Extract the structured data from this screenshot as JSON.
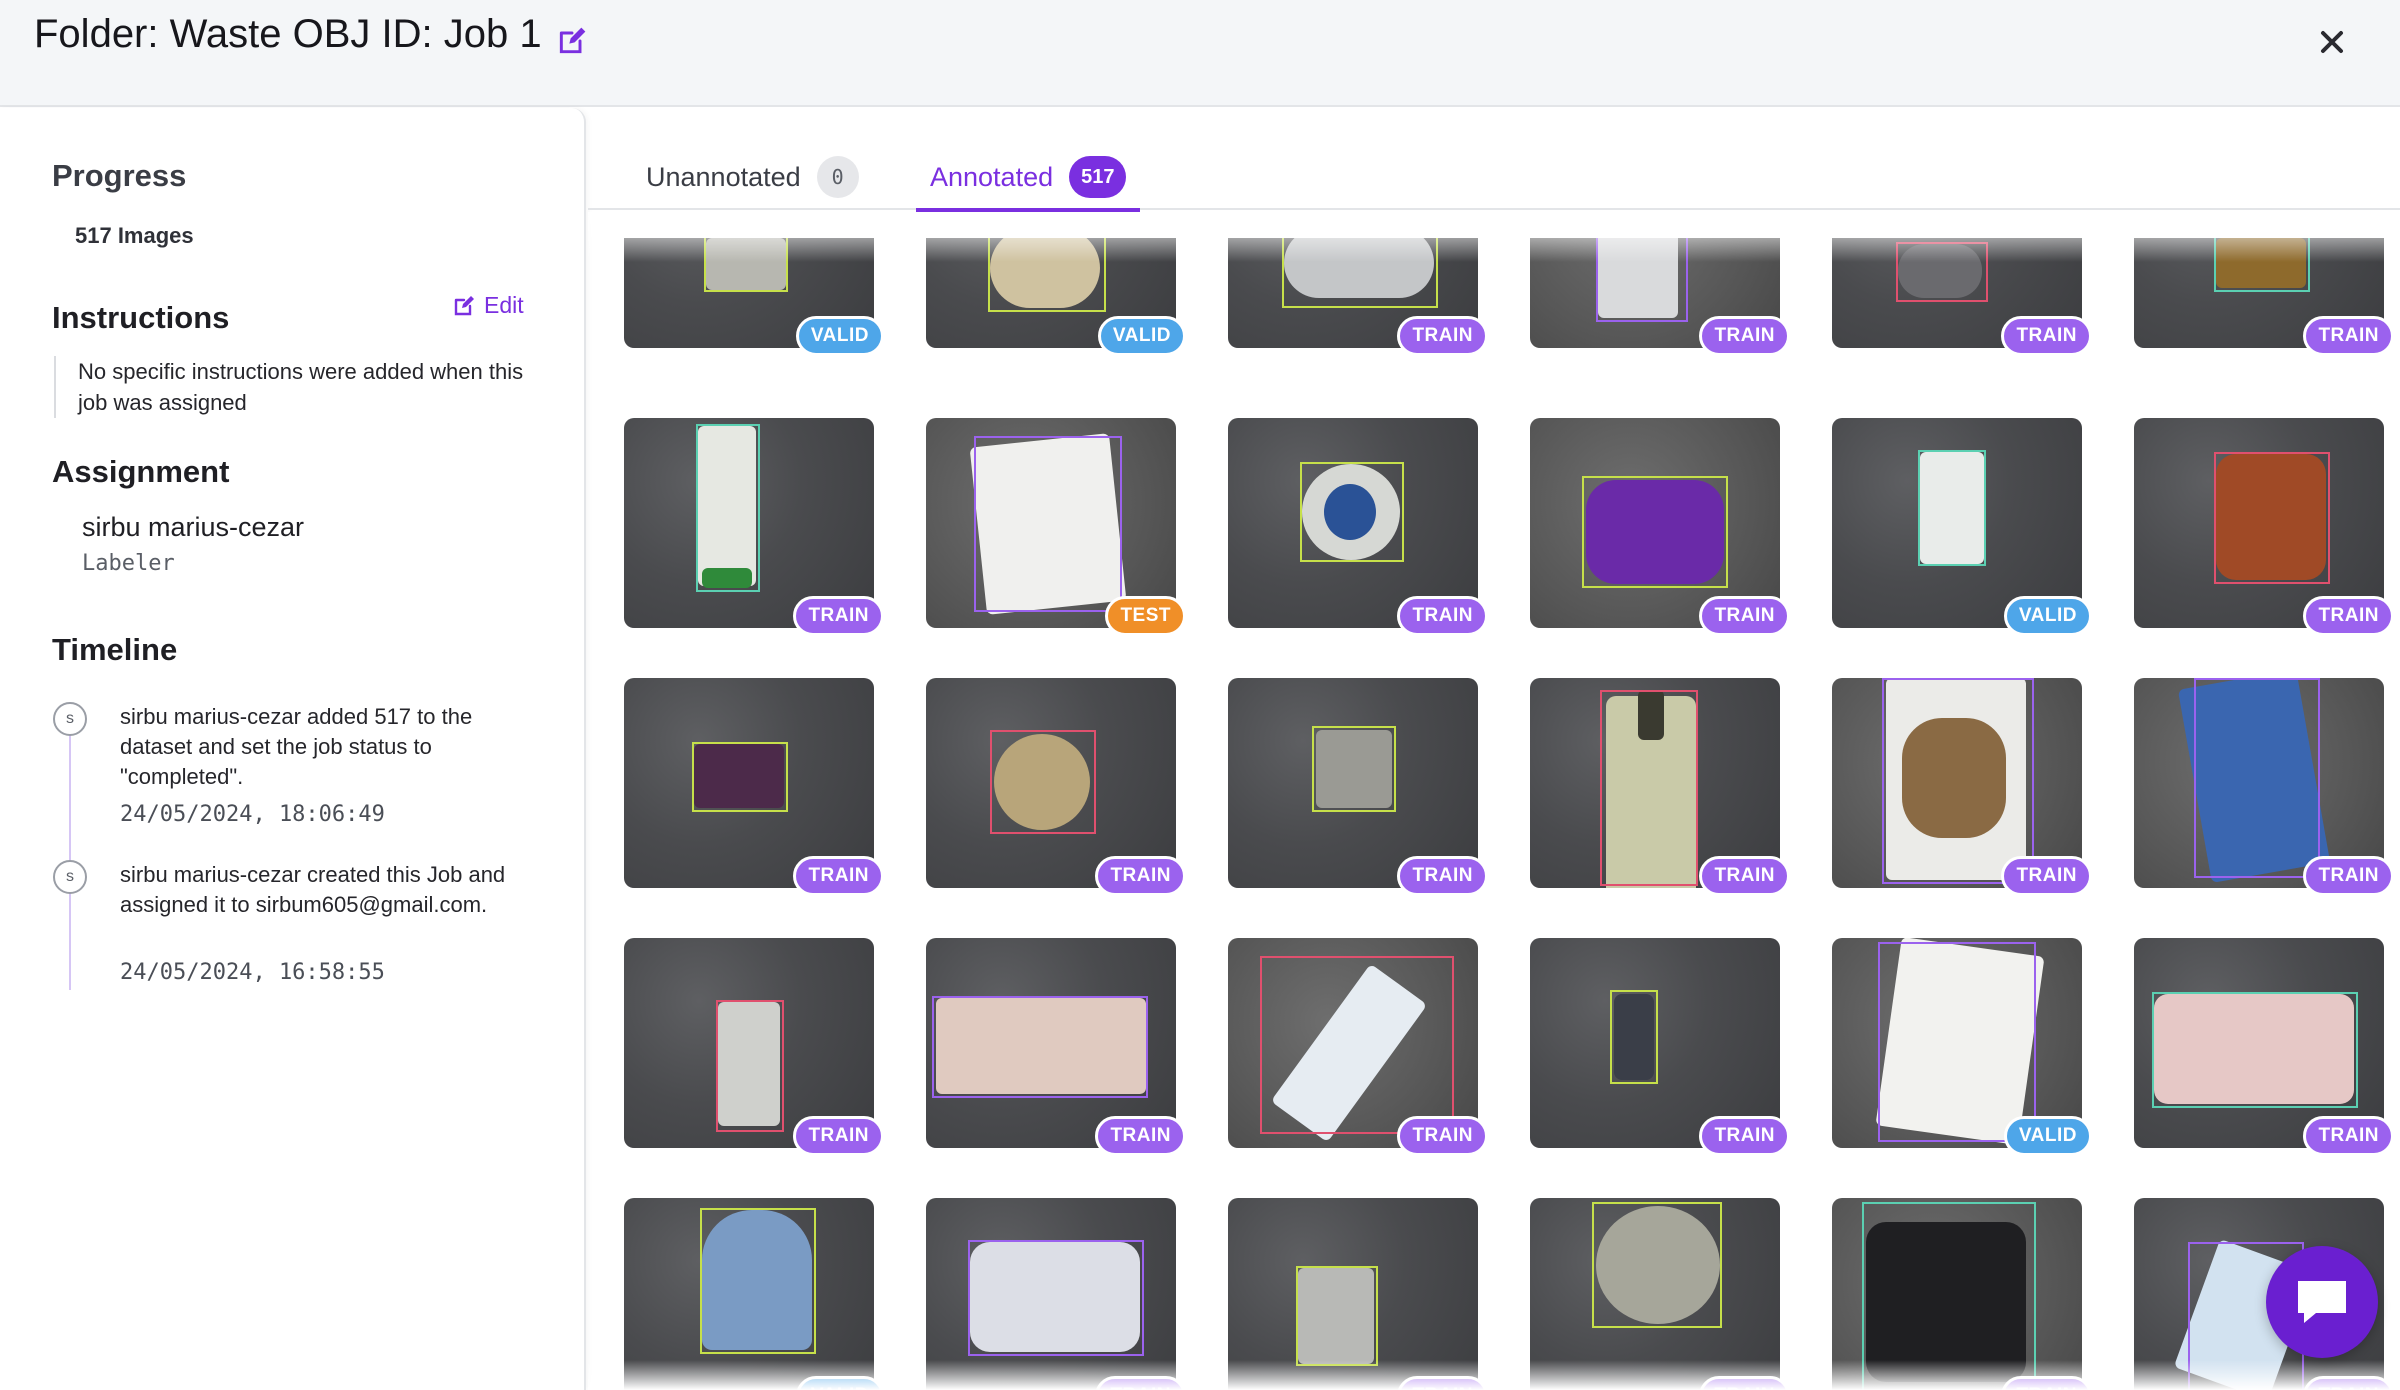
{
  "header": {
    "title": "Folder: Waste OBJ ID: Job 1"
  },
  "sidebar": {
    "progress": {
      "heading": "Progress",
      "images": "517 Images"
    },
    "instructions": {
      "heading": "Instructions",
      "edit_label": "Edit",
      "text": "No specific instructions were added when this job was assigned"
    },
    "assignment": {
      "heading": "Assignment",
      "name": "sirbu marius-cezar",
      "role": "Labeler"
    },
    "timeline": {
      "heading": "Timeline",
      "events": [
        {
          "avatar": "s",
          "text": "sirbu marius-cezar added 517 to the dataset and set the job status to \"completed\".",
          "time": "24/05/2024, 18:06:49"
        },
        {
          "avatar": "s",
          "text": "sirbu marius-cezar created this Job and assigned it to sirbum605@gmail.com.",
          "time": "24/05/2024, 16:58:55"
        }
      ]
    }
  },
  "tabs": [
    {
      "label": "Unannotated",
      "count": "0",
      "active": false
    },
    {
      "label": "Annotated",
      "count": "517",
      "active": true
    }
  ],
  "splits": [
    "VALID",
    "VALID",
    "TRAIN",
    "TRAIN",
    "TRAIN",
    "TRAIN",
    "TRAIN",
    "TEST",
    "TRAIN",
    "TRAIN",
    "VALID",
    "TRAIN",
    "TRAIN",
    "TRAIN",
    "TRAIN",
    "TRAIN",
    "TRAIN",
    "TRAIN",
    "TRAIN",
    "TRAIN",
    "TRAIN",
    "TRAIN",
    "VALID",
    "TRAIN",
    "VALID",
    "TRAIN",
    "TRAIN",
    "TRAIN",
    "TRAIN",
    "TRAIN"
  ],
  "colors": {
    "accent": "#7a2fe0",
    "train": "#9b62ee",
    "valid": "#4ea6e9",
    "test": "#f08f28"
  },
  "icons": {
    "title_edit": "pencil-square-icon",
    "close": "close-icon",
    "chat": "chat-icon"
  }
}
